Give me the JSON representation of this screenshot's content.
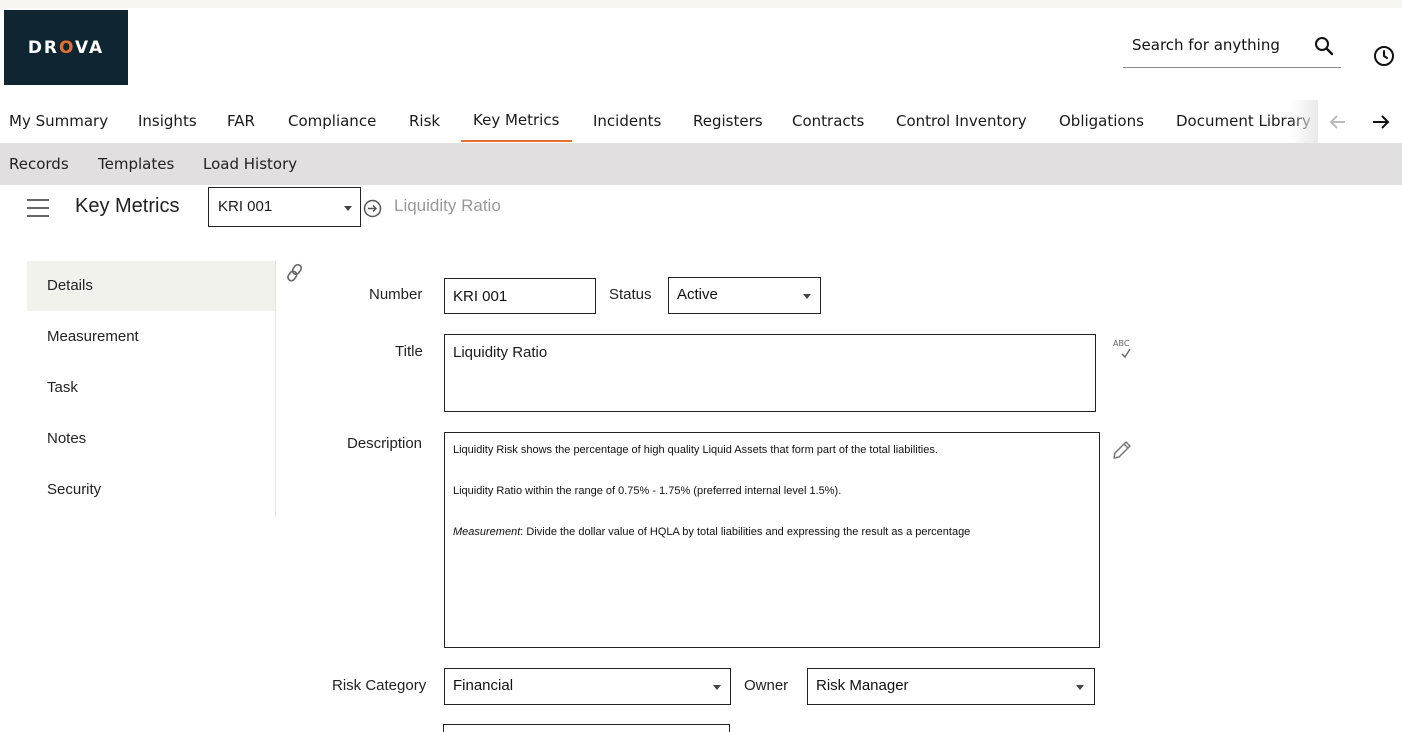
{
  "app": {
    "logo_text_1": "DR",
    "logo_text_o": "O",
    "logo_text_2": "VA"
  },
  "header": {
    "search_label": "Search for anything"
  },
  "nav": {
    "items": [
      "My Summary",
      "Insights",
      "FAR",
      "Compliance",
      "Risk",
      "Key Metrics",
      "Incidents",
      "Registers",
      "Contracts",
      "Control Inventory",
      "Obligations",
      "Document Library"
    ],
    "active": "Key Metrics",
    "accent_color": "#e8702f"
  },
  "subnav": {
    "items": [
      "Records",
      "Templates",
      "Load History"
    ]
  },
  "titlebar": {
    "page_title": "Key Metrics",
    "record_selected": "KRI 001",
    "record_name": "Liquidity Ratio"
  },
  "sidemenu": {
    "items": [
      "Details",
      "Measurement",
      "Task",
      "Notes",
      "Security"
    ],
    "active": "Details"
  },
  "form": {
    "number_label": "Number",
    "number_value": "KRI 001",
    "status_label": "Status",
    "status_value": "Active",
    "title_label": "Title",
    "title_value": "Liquidity Ratio",
    "description_label": "Description",
    "description_line1": "Liquidity Risk shows the percentage of high quality Liquid Assets that form part of the total liabilities.",
    "description_line2": "Liquidity Ratio within the range of 0.75% - 1.75% (preferred internal level 1.5%).",
    "description_line3_emph": "Measurement",
    "description_line3_rest": ": Divide the dollar value of HQLA by total liabilities and expressing the result as a percentage",
    "risk_category_label": "Risk Category",
    "risk_category_value": "Financial",
    "owner_label": "Owner",
    "owner_value": "Risk Manager",
    "spell_icon_text": "ABC"
  }
}
